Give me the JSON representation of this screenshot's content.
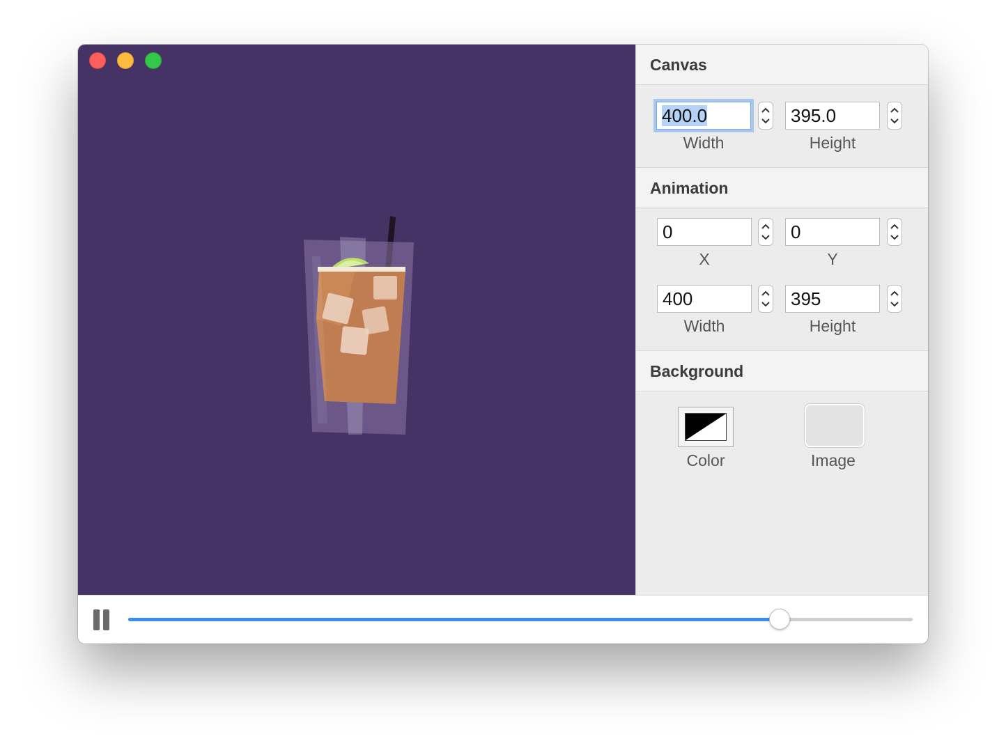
{
  "window": {
    "controls": [
      "close",
      "minimize",
      "zoom"
    ]
  },
  "canvas_area": {
    "background_color": "#463366",
    "content": "drink-illustration"
  },
  "inspector": {
    "canvas": {
      "title": "Canvas",
      "width_value": "400.0",
      "width_label": "Width",
      "height_value": "395.0",
      "height_label": "Height"
    },
    "animation": {
      "title": "Animation",
      "x_value": "0",
      "x_label": "X",
      "y_value": "0",
      "y_label": "Y",
      "width_value": "400",
      "width_label": "Width",
      "height_value": "395",
      "height_label": "Height"
    },
    "background": {
      "title": "Background",
      "color_label": "Color",
      "image_label": "Image"
    }
  },
  "playback": {
    "state": "playing",
    "control_icon": "pause-icon",
    "progress": 0.83,
    "accent_color": "#3b8df1"
  }
}
